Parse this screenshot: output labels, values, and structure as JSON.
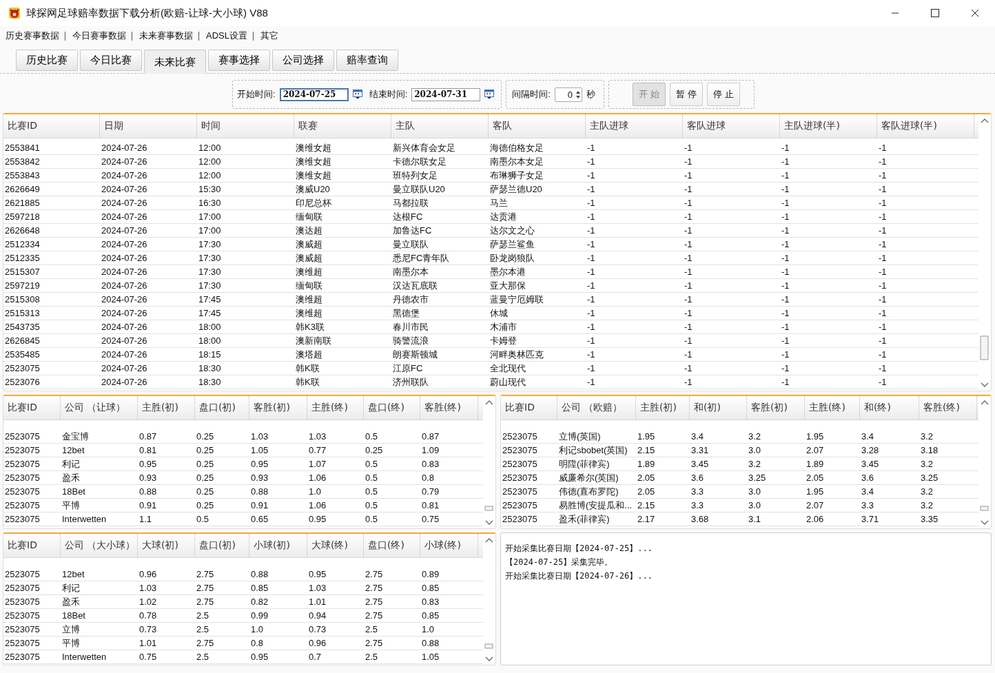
{
  "window": {
    "title": "球探网足球赔率数据下载分析(欧赔-让球-大小球) V88"
  },
  "menu": [
    "历史赛事数据",
    "今日赛事数据",
    "未来赛事数据",
    "ADSL设置",
    "其它"
  ],
  "tabs": [
    {
      "label": "历史比赛",
      "selected": false
    },
    {
      "label": "今日比赛",
      "selected": false
    },
    {
      "label": "未来比赛",
      "selected": true
    },
    {
      "label": "赛事选择",
      "selected": false
    },
    {
      "label": "公司选择",
      "selected": false
    },
    {
      "label": "赔率查询",
      "selected": false
    }
  ],
  "toolbar": {
    "start_label": "开始时间:",
    "start_date": "2024-07-25",
    "end_label": "结束时间:",
    "end_date": "2024-07-31",
    "interval_label": "间隔时间:",
    "interval": "0",
    "interval_unit": "秒",
    "buttons": [
      {
        "label": "开始",
        "disabled": true
      },
      {
        "label": "暂停",
        "disabled": false
      },
      {
        "label": "停止",
        "disabled": false
      }
    ]
  },
  "matches": {
    "columns": [
      "比赛ID",
      "日期",
      "时间",
      "联赛",
      "主队",
      "客队",
      "主队进球",
      "客队进球",
      "主队进球(半)",
      "客队进球(半)"
    ],
    "rows": [
      [
        "2553841",
        "2024-07-26",
        "12:00",
        "澳维女超",
        "新兴体育会女足",
        "海德伯格女足",
        "-1",
        "-1",
        "-1",
        "-1"
      ],
      [
        "2553842",
        "2024-07-26",
        "12:00",
        "澳维女超",
        "卡德尔联女足",
        "南墨尔本女足",
        "-1",
        "-1",
        "-1",
        "-1"
      ],
      [
        "2553843",
        "2024-07-26",
        "12:00",
        "澳维女超",
        "班特列女足",
        "布琳狮子女足",
        "-1",
        "-1",
        "-1",
        "-1"
      ],
      [
        "2626649",
        "2024-07-26",
        "15:30",
        "澳威U20",
        "曼立联队U20",
        "萨瑟兰德U20",
        "-1",
        "-1",
        "-1",
        "-1"
      ],
      [
        "2621885",
        "2024-07-26",
        "16:30",
        "印尼总杯",
        "马都拉联",
        "马兰",
        "-1",
        "-1",
        "-1",
        "-1"
      ],
      [
        "2597218",
        "2024-07-26",
        "17:00",
        "缅甸联",
        "达根FC",
        "达贡港",
        "-1",
        "-1",
        "-1",
        "-1"
      ],
      [
        "2626648",
        "2024-07-26",
        "17:00",
        "澳达超",
        "加鲁达FC",
        "达尔文之心",
        "-1",
        "-1",
        "-1",
        "-1"
      ],
      [
        "2512334",
        "2024-07-26",
        "17:30",
        "澳威超",
        "曼立联队",
        "萨瑟兰鲨鱼",
        "-1",
        "-1",
        "-1",
        "-1"
      ],
      [
        "2512335",
        "2024-07-26",
        "17:30",
        "澳威超",
        "悉尼FC青年队",
        "卧龙岗狼队",
        "-1",
        "-1",
        "-1",
        "-1"
      ],
      [
        "2515307",
        "2024-07-26",
        "17:30",
        "澳维超",
        "南墨尔本",
        "墨尔本港",
        "-1",
        "-1",
        "-1",
        "-1"
      ],
      [
        "2597219",
        "2024-07-26",
        "17:30",
        "缅甸联",
        "汉达瓦底联",
        "亚大那保",
        "-1",
        "-1",
        "-1",
        "-1"
      ],
      [
        "2515308",
        "2024-07-26",
        "17:45",
        "澳维超",
        "丹德农市",
        "蓝曼宁厄姆联",
        "-1",
        "-1",
        "-1",
        "-1"
      ],
      [
        "2515313",
        "2024-07-26",
        "17:45",
        "澳维超",
        "黑德堡",
        "休城",
        "-1",
        "-1",
        "-1",
        "-1"
      ],
      [
        "2543735",
        "2024-07-26",
        "18:00",
        "韩K3联",
        "春川市民",
        "木浦市",
        "-1",
        "-1",
        "-1",
        "-1"
      ],
      [
        "2626845",
        "2024-07-26",
        "18:00",
        "澳新南联",
        "骑警流浪",
        "卡姆登",
        "-1",
        "-1",
        "-1",
        "-1"
      ],
      [
        "2535485",
        "2024-07-26",
        "18:15",
        "澳塔超",
        "朗赛斯顿城",
        "河畔奥林匹克",
        "-1",
        "-1",
        "-1",
        "-1"
      ],
      [
        "2523075",
        "2024-07-26",
        "18:30",
        "韩K联",
        "江原FC",
        "全北现代",
        "-1",
        "-1",
        "-1",
        "-1"
      ],
      [
        "2523076",
        "2024-07-26",
        "18:30",
        "韩K联",
        "济州联队",
        "蔚山现代",
        "-1",
        "-1",
        "-1",
        "-1"
      ]
    ]
  },
  "handicap_odds": {
    "columns": [
      "比赛ID",
      "公司 （让球）",
      "主胜(初)",
      "盘口(初)",
      "客胜(初)",
      "主胜(终)",
      "盘口(终)",
      "客胜(终)"
    ],
    "rows": [
      [
        "2523075",
        "金宝博",
        "0.87",
        "0.25",
        "1.03",
        "1.03",
        "0.5",
        "0.87"
      ],
      [
        "2523075",
        "12bet",
        "0.81",
        "0.25",
        "1.05",
        "0.77",
        "0.25",
        "1.09"
      ],
      [
        "2523075",
        "利记",
        "0.95",
        "0.25",
        "0.95",
        "1.07",
        "0.5",
        "0.83"
      ],
      [
        "2523075",
        "盈禾",
        "0.93",
        "0.25",
        "0.93",
        "1.06",
        "0.5",
        "0.8"
      ],
      [
        "2523075",
        "18Bet",
        "0.88",
        "0.25",
        "0.88",
        "1.0",
        "0.5",
        "0.79"
      ],
      [
        "2523075",
        "平博",
        "0.91",
        "0.25",
        "0.91",
        "1.06",
        "0.5",
        "0.81"
      ],
      [
        "2523075",
        "Interwetten",
        "1.1",
        "0.5",
        "0.65",
        "0.95",
        "0.5",
        "0.75"
      ]
    ]
  },
  "euro_odds": {
    "columns": [
      "比赛ID",
      "公司 （欧赔）",
      "主胜(初)",
      "和(初)",
      "客胜(初)",
      "主胜(终)",
      "和(终)",
      "客胜(终)"
    ],
    "rows": [
      [
        "2523075",
        "立博(英国)",
        "1.95",
        "3.4",
        "3.2",
        "1.95",
        "3.4",
        "3.2"
      ],
      [
        "2523075",
        "利记sbobet(英国)",
        "2.15",
        "3.31",
        "3.0",
        "2.07",
        "3.28",
        "3.18"
      ],
      [
        "2523075",
        "明陞(菲律宾)",
        "1.89",
        "3.45",
        "3.2",
        "1.89",
        "3.45",
        "3.2"
      ],
      [
        "2523075",
        "威廉希尔(英国)",
        "2.05",
        "3.6",
        "3.25",
        "2.05",
        "3.6",
        "3.25"
      ],
      [
        "2523075",
        "伟德(直布罗陀)",
        "2.05",
        "3.3",
        "3.0",
        "1.95",
        "3.4",
        "3.2"
      ],
      [
        "2523075",
        "易胜博(安提瓜和...",
        "2.15",
        "3.3",
        "3.0",
        "2.07",
        "3.3",
        "3.2"
      ],
      [
        "2523075",
        "盈禾(菲律宾)",
        "2.17",
        "3.68",
        "3.1",
        "2.06",
        "3.71",
        "3.35"
      ]
    ]
  },
  "over_under_odds": {
    "columns": [
      "比赛ID",
      "公司 （大小球）",
      "大球(初)",
      "盘口(初)",
      "小球(初)",
      "大球(终)",
      "盘口(终)",
      "小球(终)"
    ],
    "rows": [
      [
        "2523075",
        "12bet",
        "0.96",
        "2.75",
        "0.88",
        "0.95",
        "2.75",
        "0.89"
      ],
      [
        "2523075",
        "利记",
        "1.03",
        "2.75",
        "0.85",
        "1.03",
        "2.75",
        "0.85"
      ],
      [
        "2523075",
        "盈禾",
        "1.02",
        "2.75",
        "0.82",
        "1.01",
        "2.75",
        "0.83"
      ],
      [
        "2523075",
        "18Bet",
        "0.78",
        "2.5",
        "0.99",
        "0.94",
        "2.75",
        "0.85"
      ],
      [
        "2523075",
        "立博",
        "0.73",
        "2.5",
        "1.0",
        "0.73",
        "2.5",
        "1.0"
      ],
      [
        "2523075",
        "平博",
        "1.01",
        "2.75",
        "0.8",
        "0.96",
        "2.75",
        "0.88"
      ],
      [
        "2523075",
        "Interwetten",
        "0.75",
        "2.5",
        "0.95",
        "0.7",
        "2.5",
        "1.05"
      ]
    ]
  },
  "log": [
    "开始采集比赛日期【2024-07-25】...",
    "【2024-07-25】采集完毕。",
    "开始采集比赛日期【2024-07-26】..."
  ]
}
